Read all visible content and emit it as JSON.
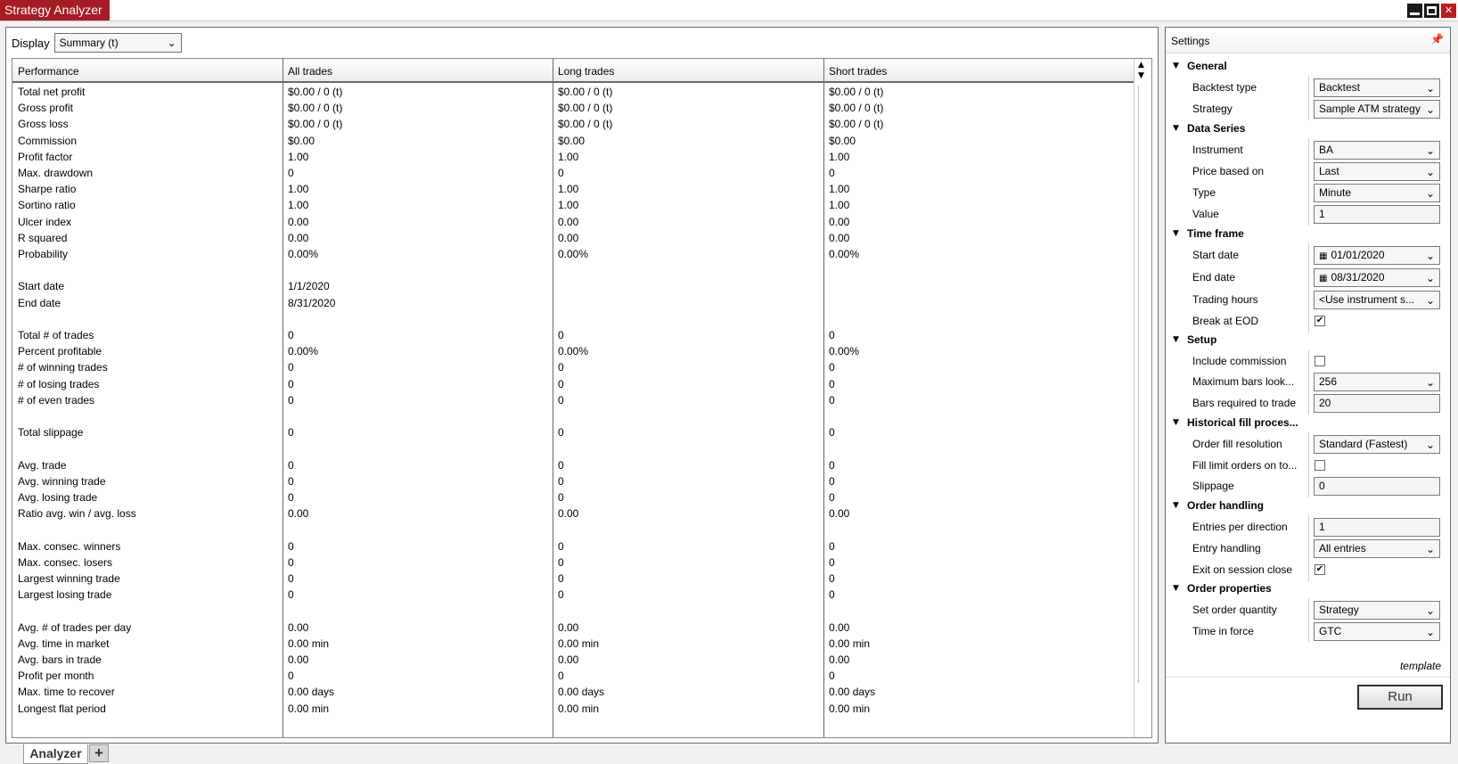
{
  "window": {
    "title": "Strategy Analyzer"
  },
  "display": {
    "label": "Display",
    "value": "Summary (t)"
  },
  "table": {
    "columns": [
      "Performance",
      "All trades",
      "Long trades",
      "Short trades"
    ],
    "rows": [
      [
        "Total net profit",
        "$0.00 / 0 (t)",
        "$0.00 / 0 (t)",
        "$0.00 / 0 (t)"
      ],
      [
        "Gross profit",
        "$0.00 / 0 (t)",
        "$0.00 / 0 (t)",
        "$0.00 / 0 (t)"
      ],
      [
        "Gross loss",
        "$0.00 / 0 (t)",
        "$0.00 / 0 (t)",
        "$0.00 / 0 (t)"
      ],
      [
        "Commission",
        "$0.00",
        "$0.00",
        "$0.00"
      ],
      [
        "Profit factor",
        "1.00",
        "1.00",
        "1.00"
      ],
      [
        "Max. drawdown",
        "0",
        "0",
        "0"
      ],
      [
        "Sharpe ratio",
        "1.00",
        "1.00",
        "1.00"
      ],
      [
        "Sortino ratio",
        "1.00",
        "1.00",
        "1.00"
      ],
      [
        "Ulcer index",
        "0.00",
        "0.00",
        "0.00"
      ],
      [
        "R squared",
        "0.00",
        "0.00",
        "0.00"
      ],
      [
        "Probability",
        "0.00%",
        "0.00%",
        "0.00%"
      ],
      [
        "",
        "",
        "",
        ""
      ],
      [
        "Start date",
        "1/1/2020",
        "",
        ""
      ],
      [
        "End date",
        "8/31/2020",
        "",
        ""
      ],
      [
        "",
        "",
        "",
        ""
      ],
      [
        "Total # of trades",
        "0",
        "0",
        "0"
      ],
      [
        "Percent profitable",
        "0.00%",
        "0.00%",
        "0.00%"
      ],
      [
        "# of winning trades",
        "0",
        "0",
        "0"
      ],
      [
        "# of losing trades",
        "0",
        "0",
        "0"
      ],
      [
        "# of even trades",
        "0",
        "0",
        "0"
      ],
      [
        "",
        "",
        "",
        ""
      ],
      [
        "Total slippage",
        "0",
        "0",
        "0"
      ],
      [
        "",
        "",
        "",
        ""
      ],
      [
        "Avg. trade",
        "0",
        "0",
        "0"
      ],
      [
        "Avg. winning trade",
        "0",
        "0",
        "0"
      ],
      [
        "Avg. losing trade",
        "0",
        "0",
        "0"
      ],
      [
        "Ratio avg. win / avg. loss",
        "0.00",
        "0.00",
        "0.00"
      ],
      [
        "",
        "",
        "",
        ""
      ],
      [
        "Max. consec. winners",
        "0",
        "0",
        "0"
      ],
      [
        "Max. consec. losers",
        "0",
        "0",
        "0"
      ],
      [
        "Largest winning trade",
        "0",
        "0",
        "0"
      ],
      [
        "Largest losing trade",
        "0",
        "0",
        "0"
      ],
      [
        "",
        "",
        "",
        ""
      ],
      [
        "Avg. # of trades per day",
        "0.00",
        "0.00",
        "0.00"
      ],
      [
        "Avg. time in market",
        "0.00 min",
        "0.00 min",
        "0.00 min"
      ],
      [
        "Avg. bars in trade",
        "0.00",
        "0.00",
        "0.00"
      ],
      [
        "Profit per month",
        "0",
        "0",
        "0"
      ],
      [
        "Max. time to recover",
        "0.00 days",
        "0.00 days",
        "0.00 days"
      ],
      [
        "Longest flat period",
        "0.00 min",
        "0.00 min",
        "0.00 min"
      ]
    ]
  },
  "tabs": {
    "active": "Analyzer",
    "add": "+"
  },
  "settings": {
    "title": "Settings",
    "template_link": "template",
    "run_label": "Run",
    "sections": [
      {
        "title": "General",
        "props": [
          {
            "label": "Backtest type",
            "kind": "select",
            "value": "Backtest"
          },
          {
            "label": "Strategy",
            "kind": "select",
            "value": "Sample ATM strategy"
          }
        ]
      },
      {
        "title": "Data Series",
        "props": [
          {
            "label": "Instrument",
            "kind": "select",
            "value": "BA"
          },
          {
            "label": "Price based on",
            "kind": "select",
            "value": "Last"
          },
          {
            "label": "Type",
            "kind": "select",
            "value": "Minute"
          },
          {
            "label": "Value",
            "kind": "text",
            "value": "1"
          }
        ]
      },
      {
        "title": "Time frame",
        "props": [
          {
            "label": "Start date",
            "kind": "date",
            "value": "01/01/2020"
          },
          {
            "label": "End date",
            "kind": "date",
            "value": "08/31/2020"
          },
          {
            "label": "Trading hours",
            "kind": "select",
            "value": "<Use instrument s..."
          },
          {
            "label": "Break at EOD",
            "kind": "check",
            "value": "checked"
          }
        ]
      },
      {
        "title": "Setup",
        "props": [
          {
            "label": "Include commission",
            "kind": "check",
            "value": "unchecked"
          },
          {
            "label": "Maximum bars look...",
            "kind": "select",
            "value": "256"
          },
          {
            "label": "Bars required to trade",
            "kind": "text",
            "value": "20"
          }
        ]
      },
      {
        "title": "Historical fill proces...",
        "props": [
          {
            "label": "Order fill resolution",
            "kind": "select",
            "value": "Standard (Fastest)"
          },
          {
            "label": "Fill limit orders on to...",
            "kind": "check",
            "value": "unchecked"
          },
          {
            "label": "Slippage",
            "kind": "text",
            "value": "0"
          }
        ]
      },
      {
        "title": "Order handling",
        "props": [
          {
            "label": "Entries per direction",
            "kind": "text",
            "value": "1"
          },
          {
            "label": "Entry handling",
            "kind": "select",
            "value": "All entries"
          },
          {
            "label": "Exit on session close",
            "kind": "check",
            "value": "checked"
          }
        ]
      },
      {
        "title": "Order properties",
        "props": [
          {
            "label": "Set order quantity",
            "kind": "select",
            "value": "Strategy"
          },
          {
            "label": "Time in force",
            "kind": "select",
            "value": "GTC"
          }
        ]
      }
    ]
  }
}
